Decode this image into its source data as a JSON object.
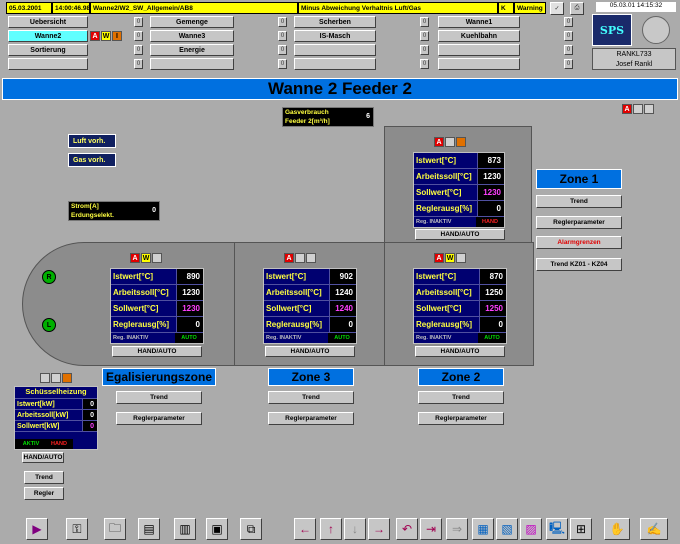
{
  "header": {
    "date": "05.03.2001",
    "time": "14:00:46.986",
    "tag": "Wanne2/W2_SW_Allgemein/AB8",
    "message": "Minus Abweichung Verhaltnis Luft/Gas",
    "class": "K",
    "level": "Warning",
    "clock": "05.03.01 14:15:32",
    "user_id": "RANKL733",
    "user_name": "Josef Rankl",
    "logo": "SPS"
  },
  "nav": {
    "r1": [
      "Uebersicht",
      "Gemenge",
      "Scherben",
      "Wanne1"
    ],
    "r2": [
      "Wanne2",
      "Wanne3",
      "IS-Masch",
      "Kuehlbahn"
    ],
    "r3": [
      "Sortierung",
      "Energie",
      "",
      ""
    ]
  },
  "title": "Wanne 2 Feeder 2",
  "gas": {
    "label1": "Gasverbrauch",
    "label2": "Feeder 2[m³/h]",
    "value": "6"
  },
  "luft": "Luft vorh.",
  "gasv": "Gas vorh.",
  "strom": {
    "label1": "Strom[A]",
    "label2": "Erdungselekt.",
    "value": "0"
  },
  "labels": {
    "ist": "Istwert[°C]",
    "arb": "Arbeitssoll[°C]",
    "soll": "Sollwert[°C]",
    "regler": "Reglerausg[%]",
    "reg": "Reg. INAKTIV",
    "handauto": "HAND/AUTO",
    "trend": "Trend",
    "reglerparam": "Reglerparameter",
    "alarm": "Alarmgrenzen",
    "trendkz": "Trend KZ01 - KZ04",
    "r": "R",
    "l": "L"
  },
  "zone1": {
    "name": "Zone 1",
    "ist": "873",
    "arb": "1230",
    "soll": "1230",
    "regler": "0",
    "mode": "HAND"
  },
  "zone2": {
    "name": "Zone 2",
    "ist": "870",
    "arb": "1250",
    "soll": "1250",
    "regler": "0",
    "mode": "AUTO"
  },
  "zone3": {
    "name": "Zone 3",
    "ist": "902",
    "arb": "1240",
    "soll": "1240",
    "regler": "0",
    "mode": "AUTO"
  },
  "egal": {
    "name": "Egalisierungszone",
    "ist": "890",
    "arb": "1230",
    "soll": "1230",
    "regler": "0",
    "mode": "AUTO"
  },
  "schuessel": {
    "title": "Schüsselheizung",
    "ist_l": "Istwert[kW]",
    "arb_l": "Arbeitssoll[kW]",
    "soll_l": "Sollwert[kW]",
    "ist": "0",
    "arb": "0",
    "soll": "0",
    "s1": "AKTIV",
    "s2": "HAND",
    "handauto": "HAND/AUTO",
    "trend": "Trend",
    "regler": "Regler"
  },
  "colors": {
    "title_bar": "#0070e0",
    "panel": "#000070",
    "label": "#ffff40"
  }
}
